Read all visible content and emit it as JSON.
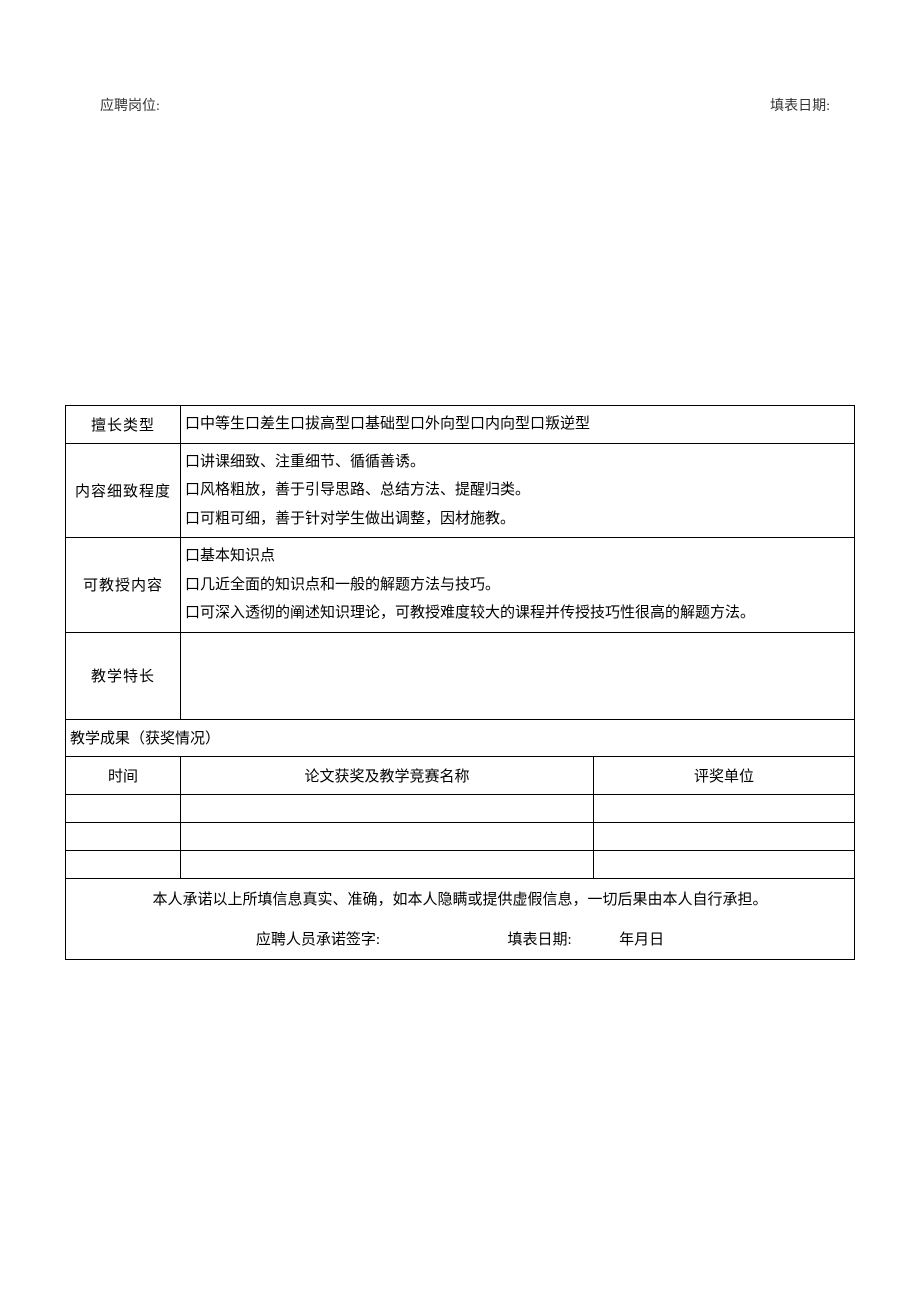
{
  "header": {
    "left_label": "应聘岗位:",
    "right_label": "填表日期:"
  },
  "rows": {
    "specialty_type": {
      "label": "擅长类型",
      "options_line": "口中等生口差生口拔高型口基础型口外向型口内向型口叛逆型"
    },
    "detail_level": {
      "label": "内容细致程度",
      "line1": "口讲课细致、注重细节、循循善诱。",
      "line2": "口风格粗放，善于引导思路、总结方法、提醒归类。",
      "line3": "口可粗可细，善于针对学生做出调整，因材施教。"
    },
    "teachable_content": {
      "label": "可教授内容",
      "line1": "口基本知识点",
      "line2": "口几近全面的知识点和一般的解题方法与技巧。",
      "line3": "口可深入透彻的阐述知识理论，可教授难度较大的课程并传授技巧性很高的解题方法。"
    },
    "teaching_specialty": {
      "label": "教学特长"
    }
  },
  "achievements": {
    "header": "教学成果（获奖情况）",
    "th_time": "时间",
    "th_name": "论文获奖及教学竞赛名称",
    "th_unit": "评奖单位"
  },
  "declaration": "本人承诺以上所填信息真实、准确，如本人隐瞒或提供虚假信息，一切后果由本人自行承担。",
  "signature": {
    "sign_label": "应聘人员承诺签字:",
    "date_label": "填表日期:",
    "date_value": "年月日"
  }
}
